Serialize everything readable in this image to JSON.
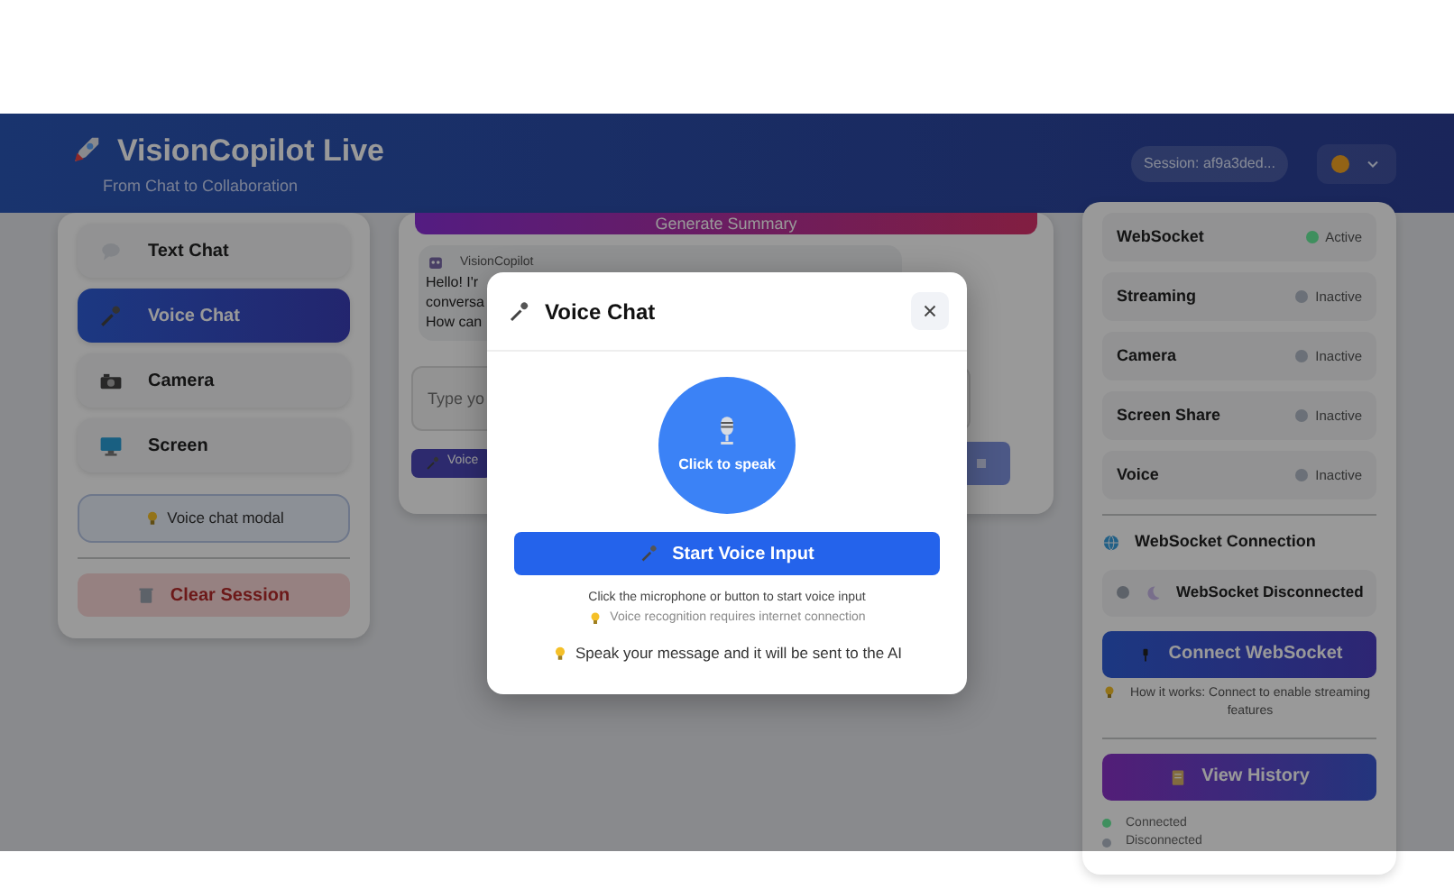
{
  "header": {
    "title": "VisionCopilot Live",
    "subtitle": "From Chat to Collaboration",
    "session": "Session: af9a3ded..."
  },
  "sidebar": {
    "items": [
      {
        "label": "Text Chat",
        "selected": false
      },
      {
        "label": "Voice Chat",
        "selected": true
      },
      {
        "label": "Camera",
        "selected": false
      },
      {
        "label": "Screen",
        "selected": false
      }
    ],
    "hint": "Voice chat modal",
    "clear_button": "Clear Session"
  },
  "chat": {
    "summary_button": "Generate Summary",
    "message": {
      "sender": "VisionCopilot",
      "lines": [
        "Hello! I'r",
        "conversa",
        "How can"
      ]
    },
    "input_placeholder": "Type yo",
    "voice_button": "Voice"
  },
  "status_panel": {
    "rows": [
      {
        "label": "WebSocket",
        "state": "Active",
        "color": "#3f8f5e"
      },
      {
        "label": "Streaming",
        "state": "Inactive",
        "color": "#6b7078"
      },
      {
        "label": "Camera",
        "state": "Inactive",
        "color": "#6b7078"
      },
      {
        "label": "Screen Share",
        "state": "Inactive",
        "color": "#6b7078"
      },
      {
        "label": "Voice",
        "state": "Inactive",
        "color": "#6b7078"
      }
    ],
    "connection_title": "WebSocket Connection",
    "connection_status": "WebSocket Disconnected",
    "connect_button": "Connect WebSocket",
    "how_it_works": "How it works: Connect to enable streaming features",
    "history_button": "View History",
    "legend": [
      {
        "label": "Connected",
        "color": "#3f8f5e"
      },
      {
        "label": "Disconnected",
        "color": "#6b7078"
      }
    ]
  },
  "modal": {
    "title": "Voice Chat",
    "mic_label": "Click to speak",
    "start_button": "Start Voice Input",
    "help": "Click the microphone or button to start voice input",
    "note": "Voice recognition requires internet connection",
    "tip": "Speak your message and it will be sent to the AI"
  }
}
